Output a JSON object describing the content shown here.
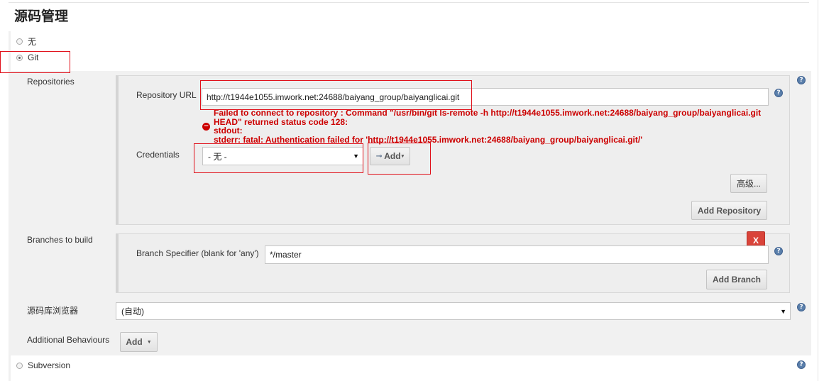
{
  "section": {
    "title": "源码管理"
  },
  "scm_options": {
    "none_label": "无",
    "git_label": "Git",
    "subversion_label": "Subversion"
  },
  "repositories": {
    "label": "Repositories",
    "url_label": "Repository URL",
    "url_value": "http://t1944e1055.imwork.net:24688/baiyang_group/baiyanglicai.git",
    "error_lines": [
      "Failed to connect to repository : Command \"/usr/bin/git ls-remote -h http://t1944e1055.imwork.net:24688/baiyang_group/baiyanglicai.git",
      "HEAD\" returned status code 128:",
      "stdout:",
      "stderr: fatal: Authentication failed for 'http://t1944e1055.imwork.net:24688/baiyang_group/baiyanglicai.git/'"
    ],
    "credentials_label": "Credentials",
    "credentials_value": "- 无 -",
    "add_credentials_label": "Add",
    "advanced_label": "高级...",
    "add_repository_label": "Add Repository"
  },
  "branches": {
    "label": "Branches to build",
    "specifier_label": "Branch Specifier (blank for 'any')",
    "specifier_value": "*/master",
    "delete_label": "X",
    "add_branch_label": "Add Branch"
  },
  "browser": {
    "label": "源码库浏览器",
    "value": "(自动)"
  },
  "behaviours": {
    "label": "Additional Behaviours",
    "add_label": "Add"
  },
  "icons": {
    "help": "?",
    "error": "minus-circle-icon",
    "key": "key-icon",
    "dropdown": "caret-down-icon"
  },
  "colors": {
    "error": "#cc0000",
    "highlight": "#e0101a",
    "help": "#5a7fab",
    "delete": "#d9443a"
  }
}
